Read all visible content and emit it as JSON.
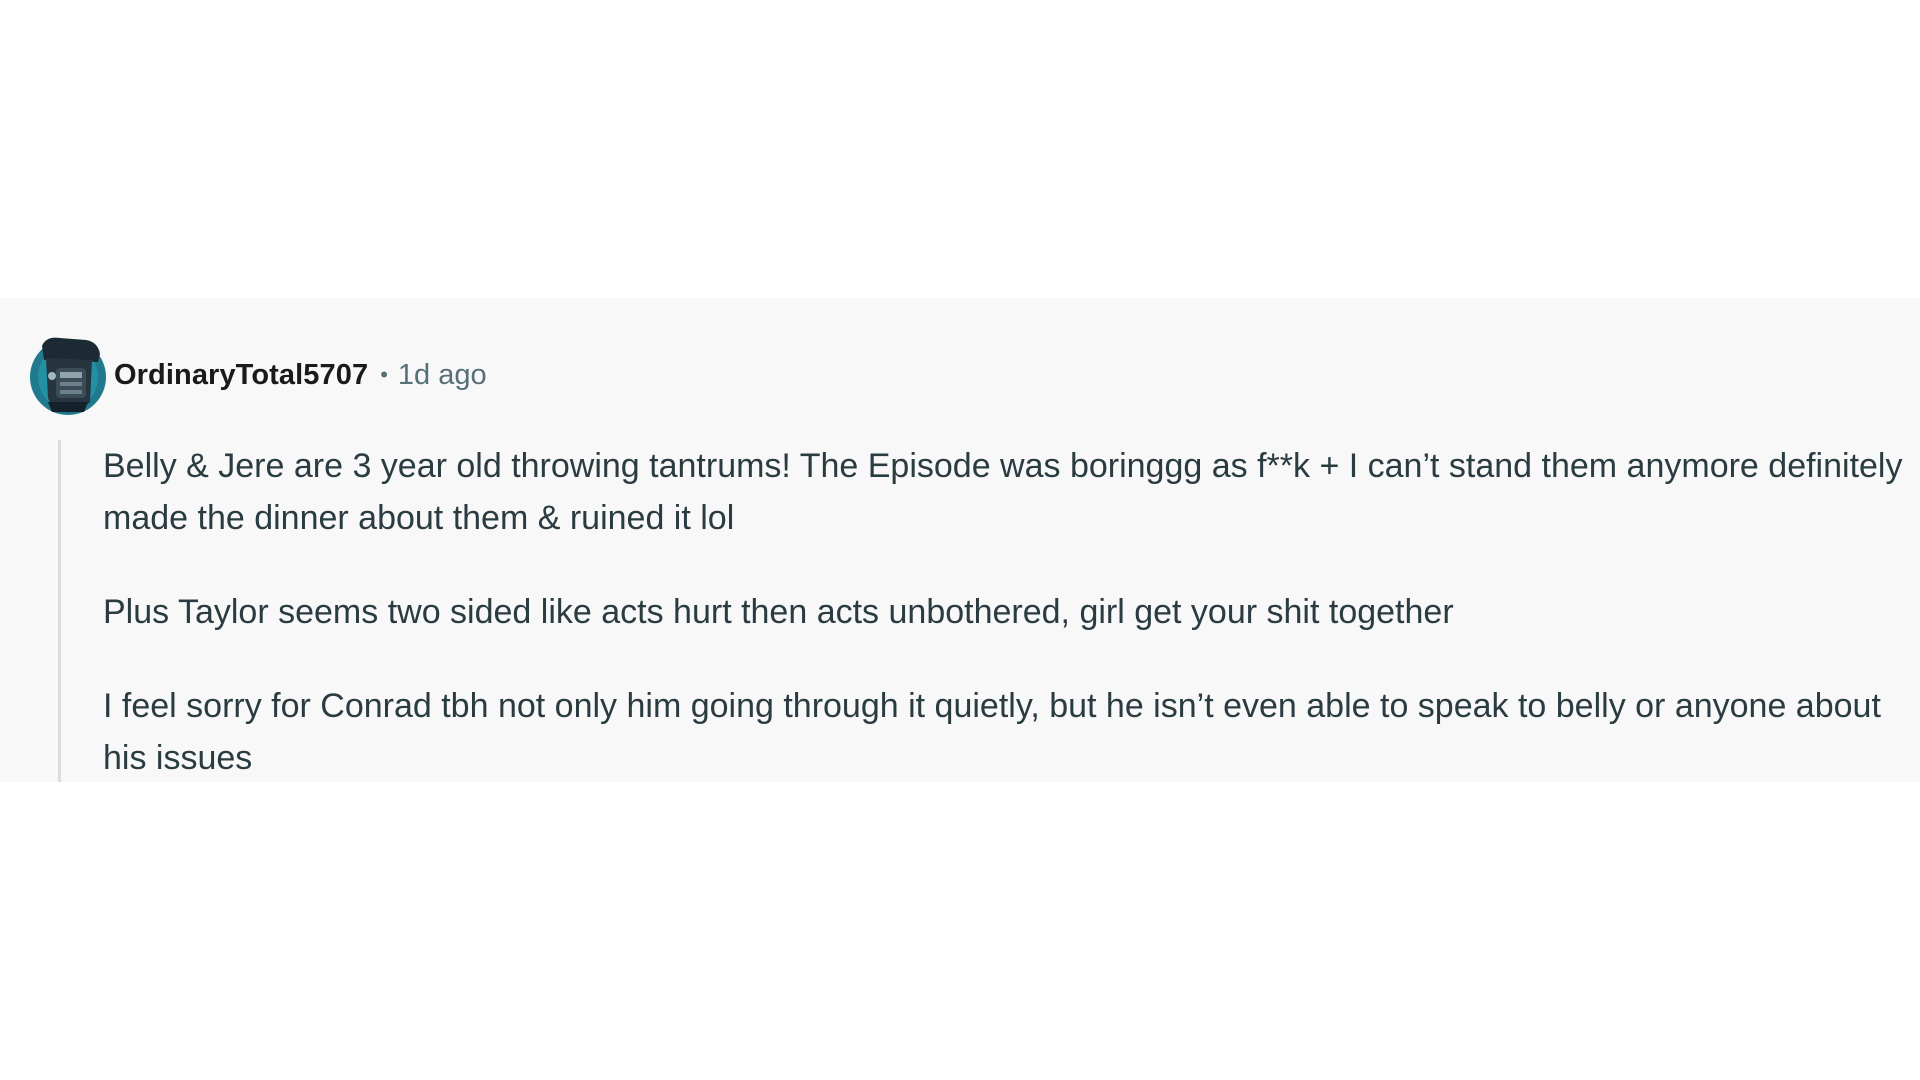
{
  "comment": {
    "avatar_icon": "snoo-avatar-icon",
    "username": "OrdinaryTotal5707",
    "separator": "•",
    "timestamp": "1d ago",
    "paragraphs": [
      "Belly & Jere are 3 year old throwing tantrums! The Episode was boringgg as f**k + I can’t stand them anymore definitely made the dinner about them & ruined it lol",
      "Plus Taylor seems two sided like acts hurt then acts unbothered, girl get your shit together",
      "I feel sorry for Conrad tbh not only him going through it quietly, but he isn’t even able to speak to belly or anyone about his issues"
    ]
  },
  "colors": {
    "card_background": "#f8f8f8",
    "username": "#1a1a1b",
    "meta": "#576f76",
    "body_text": "#2a3c42",
    "thread_line": "#dadcdd",
    "avatar_accent": "#1e7a8c"
  }
}
